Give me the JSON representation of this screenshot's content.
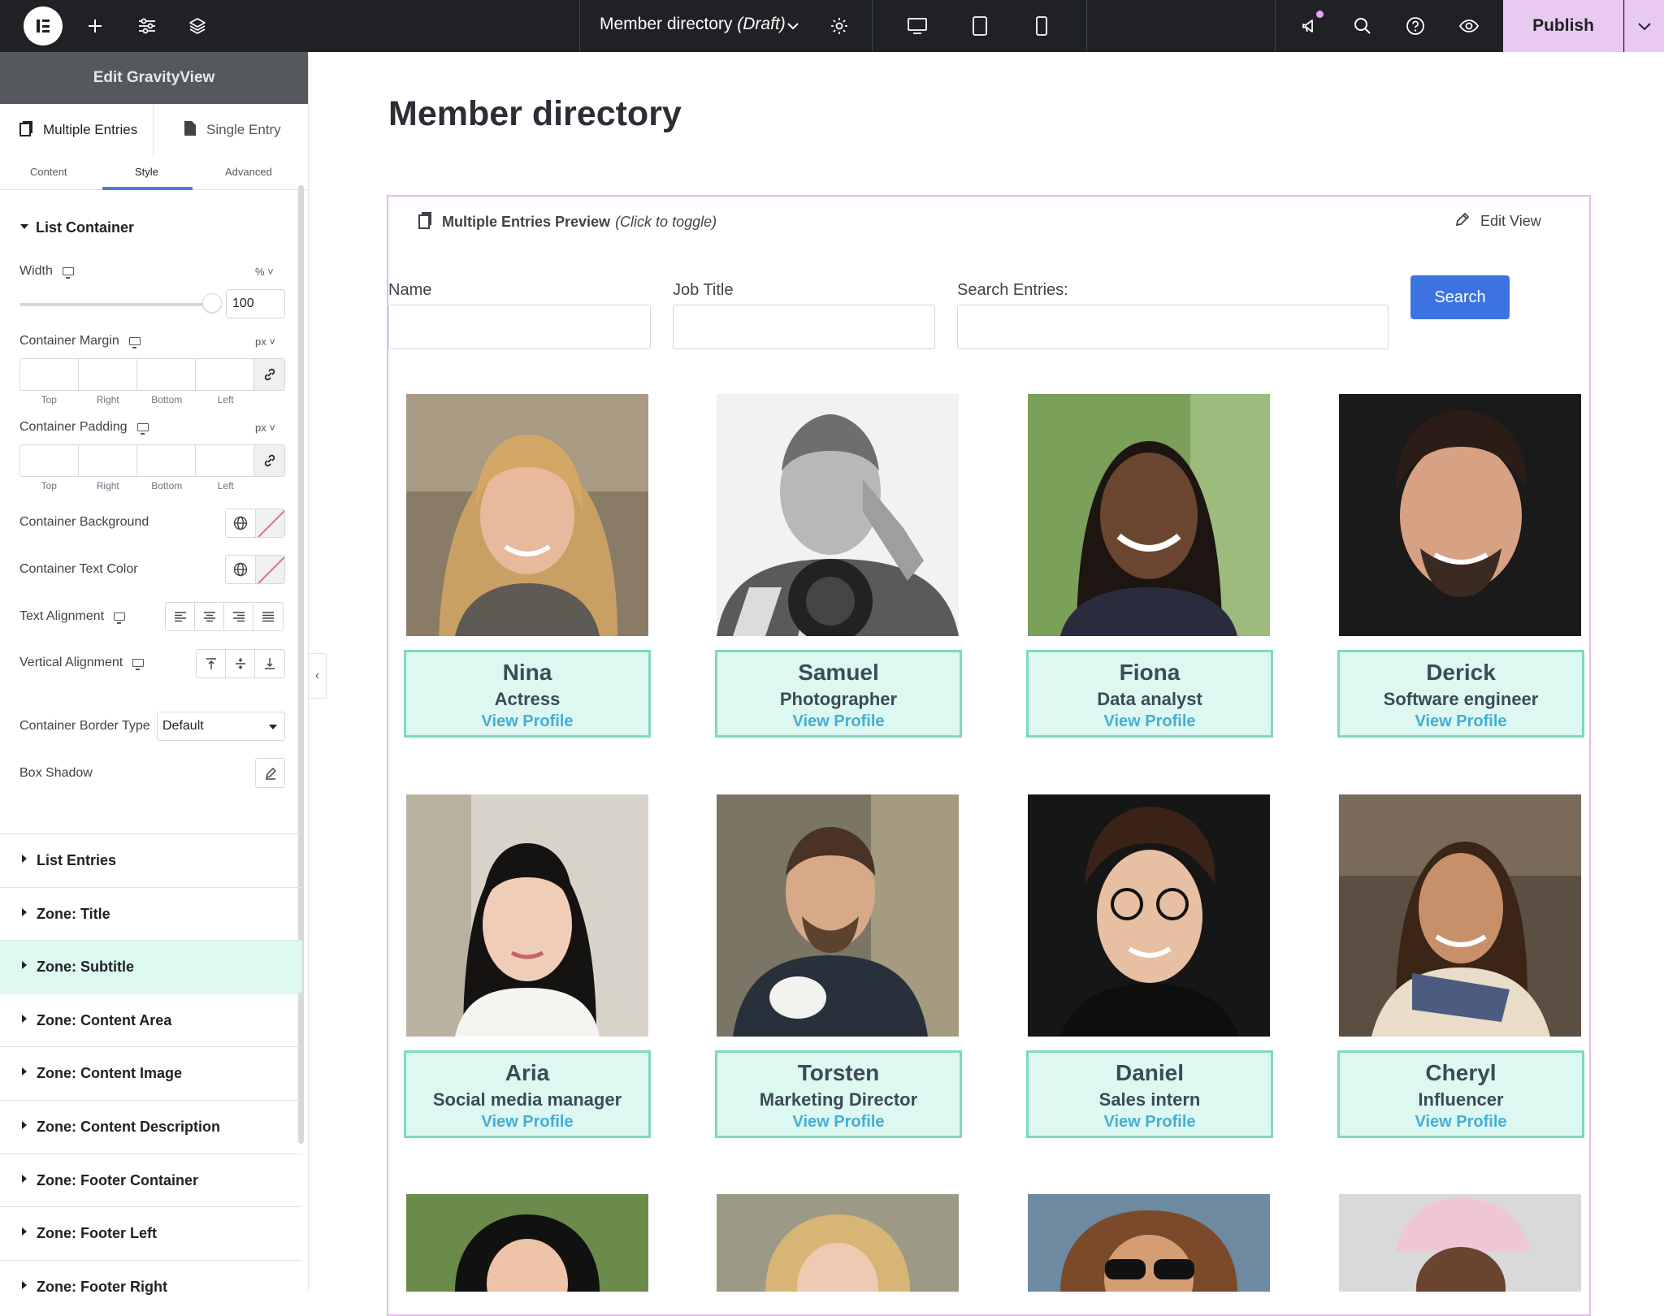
{
  "topbar": {
    "page_name": "Member directory",
    "page_status": "(Draft)",
    "publish_label": "Publish"
  },
  "panel": {
    "title": "Edit GravityView",
    "entry_tabs": [
      "Multiple Entries",
      "Single Entry"
    ],
    "sub_tabs": [
      "Content",
      "Style",
      "Advanced"
    ],
    "active_sub_tab": "Style",
    "section_title": "List Container",
    "width_label": "Width",
    "width_unit": "%",
    "width_value": "100",
    "margin_label": "Container Margin",
    "margin_unit": "px",
    "padding_label": "Container Padding",
    "padding_unit": "px",
    "dim_labels": [
      "Top",
      "Right",
      "Bottom",
      "Left"
    ],
    "background_label": "Container Background",
    "text_color_label": "Container Text Color",
    "text_align_label": "Text Alignment",
    "vertical_align_label": "Vertical Alignment",
    "border_type_label": "Container Border Type",
    "border_type_value": "Default",
    "box_shadow_label": "Box Shadow",
    "zones": [
      "List Entries",
      "Zone: Title",
      "Zone: Subtitle",
      "Zone: Content Area",
      "Zone: Content Image",
      "Zone: Content Description",
      "Zone: Footer Container",
      "Zone: Footer Left",
      "Zone: Footer Right"
    ],
    "highlighted_zone": "Zone: Subtitle"
  },
  "canvas": {
    "title": "Member directory",
    "preview_label": "Multiple Entries Preview",
    "preview_hint": "(Click to toggle)",
    "edit_view": "Edit View",
    "search_fields": [
      "Name",
      "Job Title",
      "Search Entries:"
    ],
    "search_button": "Search",
    "link_label": "View Profile"
  },
  "members": [
    {
      "name": "Nina",
      "job": "Actress"
    },
    {
      "name": "Samuel",
      "job": "Photographer"
    },
    {
      "name": "Fiona",
      "job": "Data analyst"
    },
    {
      "name": "Derick",
      "job": "Software engineer"
    },
    {
      "name": "Aria",
      "job": "Social media manager"
    },
    {
      "name": "Torsten",
      "job": "Marketing Director"
    },
    {
      "name": "Daniel",
      "job": "Sales intern"
    },
    {
      "name": "Cheryl",
      "job": "Influencer"
    }
  ],
  "colors": {
    "accent_publish": "#e8c9f1",
    "card_bg": "#ddf7f1",
    "card_border": "#7dd9c4",
    "link": "#44aed6",
    "search_button": "#3c73e0",
    "preview_border": "#e6b9f0"
  }
}
